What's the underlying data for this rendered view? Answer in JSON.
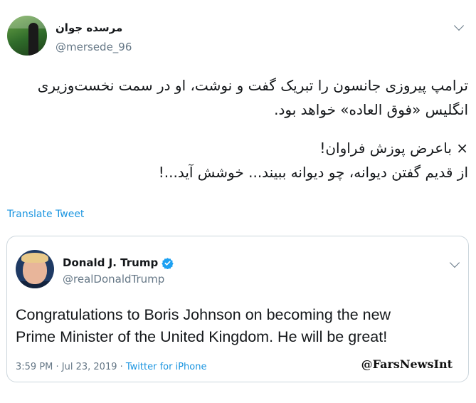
{
  "author": {
    "display_name": "مرسده جوان",
    "handle": "@mersede_96"
  },
  "tweet": {
    "lines": [
      "ترامپ پیروزی جانسون را تبریک گفت و نوشت، او در سمت نخست‌وزیری",
      "انگلیس «فوق العاده» خواهد بود.",
      "× باعرض پوزش فراوان!",
      "از قدیم گفتن دیوانه، چو دیوانه ببیند... خوشش آید...!"
    ]
  },
  "translate_label": "Translate Tweet",
  "quoted": {
    "display_name": "Donald J. Trump",
    "handle": "@realDonaldTrump",
    "text_lines": [
      "Congratulations to Boris Johnson on becoming the new",
      "Prime Minister of the United Kingdom. He will be great!"
    ],
    "timestamp": "3:59 PM · Jul 23, 2019 · ",
    "source": "Twitter for iPhone",
    "watermark": "@FarsNewsInt"
  },
  "icons": {
    "menu": "chevron-down-icon",
    "verified": "verified-badge-icon"
  },
  "colors": {
    "link": "#1b95e0",
    "secondary": "#657786",
    "border": "#ccd6dd"
  }
}
